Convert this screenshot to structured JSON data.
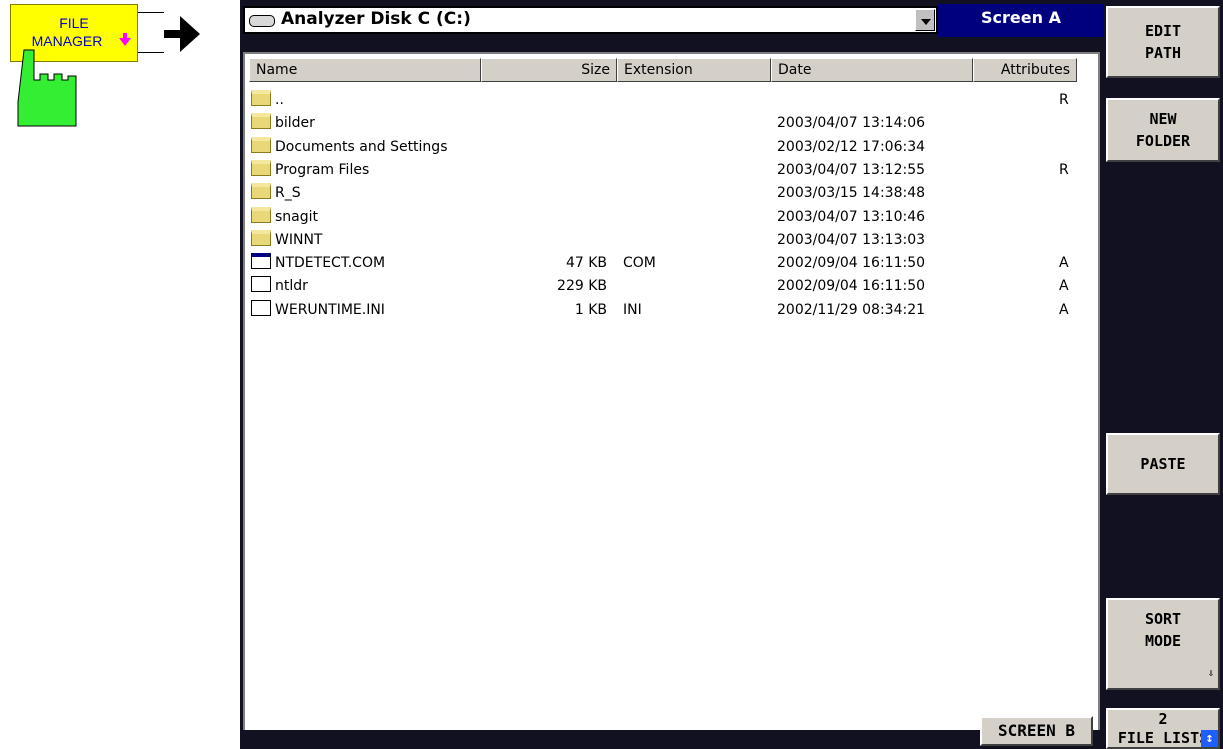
{
  "hardkey": {
    "label_line1": "FILE",
    "label_line2": "MANAGER"
  },
  "path": {
    "drive_label": "Analyzer Disk C (C:)"
  },
  "screen_title": "Screen A",
  "columns": {
    "name": "Name",
    "size": "Size",
    "extension": "Extension",
    "date": "Date",
    "attributes": "Attributes"
  },
  "files": [
    {
      "icon": "folder-icon",
      "name": "..",
      "size": "",
      "ext": "",
      "date": "",
      "attr": "R"
    },
    {
      "icon": "folder-icon",
      "name": "bilder",
      "size": "",
      "ext": "",
      "date": "2003/04/07 13:14:06",
      "attr": ""
    },
    {
      "icon": "folder-icon",
      "name": "Documents and Settings",
      "size": "",
      "ext": "",
      "date": "2003/02/12 17:06:34",
      "attr": ""
    },
    {
      "icon": "folder-icon",
      "name": "Program Files",
      "size": "",
      "ext": "",
      "date": "2003/04/07 13:12:55",
      "attr": "R"
    },
    {
      "icon": "folder-icon",
      "name": "R_S",
      "size": "",
      "ext": "",
      "date": "2003/03/15 14:38:48",
      "attr": ""
    },
    {
      "icon": "folder-icon",
      "name": "snagit",
      "size": "",
      "ext": "",
      "date": "2003/04/07 13:10:46",
      "attr": ""
    },
    {
      "icon": "folder-icon",
      "name": "WINNT",
      "size": "",
      "ext": "",
      "date": "2003/04/07 13:13:03",
      "attr": ""
    },
    {
      "icon": "application-icon",
      "name": "NTDETECT.COM",
      "size": "47 KB",
      "ext": "COM",
      "date": "2002/09/04 16:11:50",
      "attr": "A"
    },
    {
      "icon": "system-file-icon",
      "name": "ntldr",
      "size": "229 KB",
      "ext": "",
      "date": "2002/09/04 16:11:50",
      "attr": "A"
    },
    {
      "icon": "ini-file-icon",
      "name": "WERUNTIME.INI",
      "size": "1 KB",
      "ext": "INI",
      "date": "2002/11/29 08:34:21",
      "attr": "A"
    }
  ],
  "bottom": {
    "screen_b": "SCREEN B"
  },
  "softkeys": {
    "edit_path": [
      "EDIT",
      "PATH"
    ],
    "new_folder": [
      "NEW",
      "FOLDER"
    ],
    "paste": "PASTE",
    "sort_mode": [
      "SORT",
      "MODE"
    ],
    "file_lists": [
      "2",
      "FILE LISTS"
    ]
  },
  "colors": {
    "hardkey": "#ffff00",
    "hand": "#33ee33",
    "title_bar": "#00007f",
    "screen_bg": "#111122"
  }
}
